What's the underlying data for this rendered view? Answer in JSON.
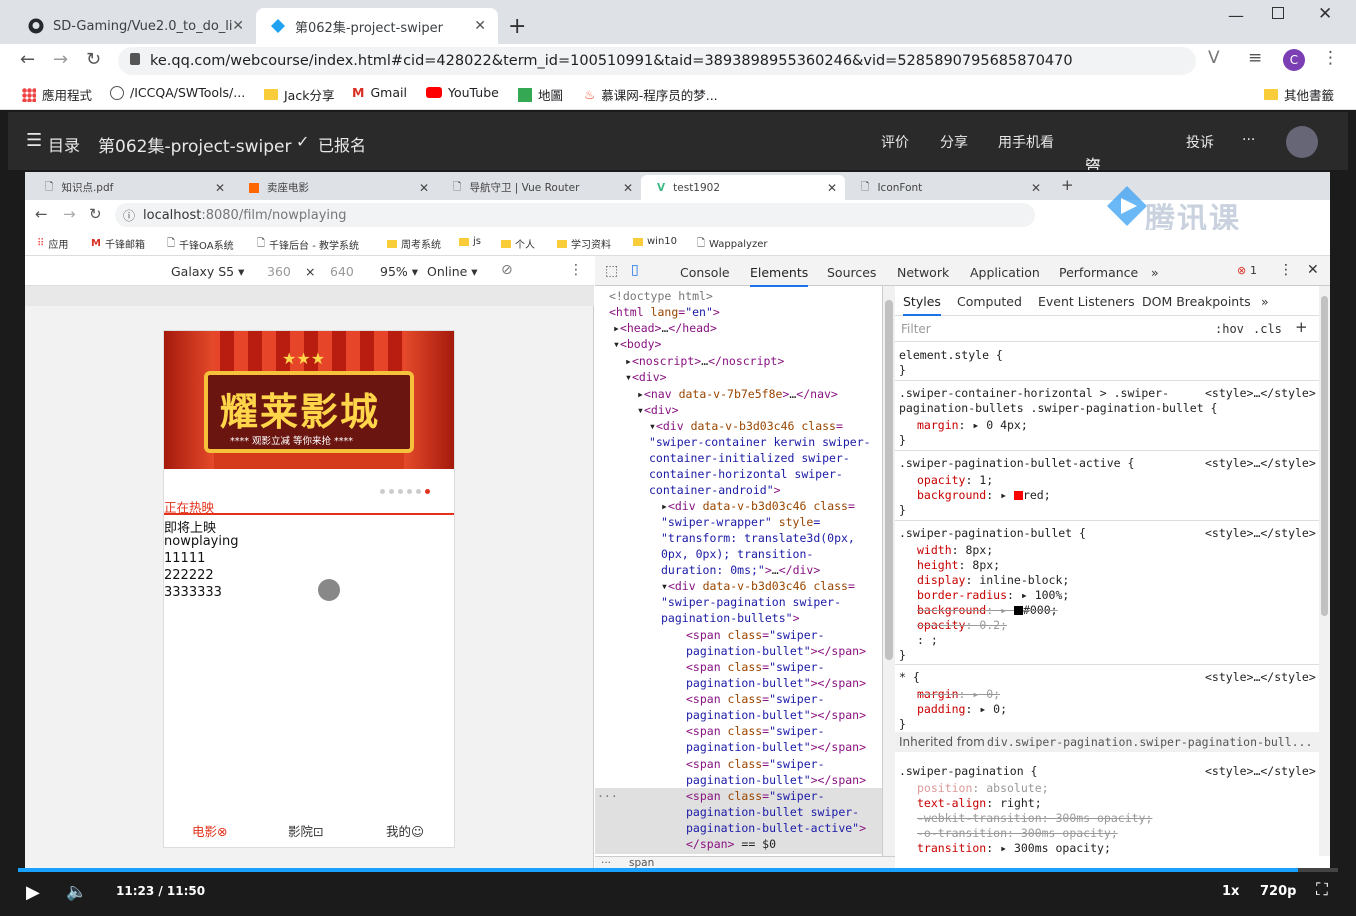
{
  "outer": {
    "tabs": [
      {
        "label": "SD-Gaming/Vue2.0_to_do_list",
        "icon": "github-icon"
      },
      {
        "label": "第062集-project-swiper",
        "icon": "tencent-classroom-icon"
      }
    ],
    "url": "ke.qq.com/webcourse/index.html#cid=428022&term_id=100510991&taid=3893898955360246&vid=5285890795685870470",
    "bookmarks": [
      "應用程式",
      "/ICCQA/SWTools/...",
      "Jack分享",
      "Gmail",
      "YouTube",
      "地圖",
      "慕课网-程序员的梦...",
      "其他書籤"
    ],
    "profile_initial": "C"
  },
  "site": {
    "menu": "目录",
    "title": "第062集-project-swiper",
    "enrolled": "已报名",
    "actions": [
      "评价",
      "分享",
      "用手机看",
      "咨询老师",
      "投诉",
      "···"
    ]
  },
  "inner": {
    "tabs": [
      "知识点.pdf",
      "卖座电影",
      "导航守卫 | Vue Router",
      "test1902",
      "IconFont"
    ],
    "url_host": "localhost",
    "url_path": ":8080/film/nowplaying",
    "bookmarks": [
      "应用",
      "千锋邮箱",
      "千锋OA系统",
      "千锋后台 - 教学系统",
      "周考系统",
      "js",
      "个人",
      "学习资料",
      "win10",
      "Wappalyzer"
    ],
    "watermark": "腾讯课堂"
  },
  "device": {
    "model": "Galaxy S5",
    "width": "360",
    "times": "×",
    "height": "640",
    "zoom": "95%",
    "network": "Online"
  },
  "app": {
    "banner_title": "耀莱影城",
    "banner_sub": "**** 观影立减 等你来抢 ****",
    "lines": [
      "正在热映",
      "即将上映",
      "nowplaying",
      "11111",
      "222222",
      "3333333"
    ],
    "tabbar": [
      "电影",
      "影院",
      "我的"
    ]
  },
  "devtools": {
    "tabs": [
      "Console",
      "Elements",
      "Sources",
      "Network",
      "Application",
      "Performance",
      "»"
    ],
    "error_count": "1",
    "style_tabs": [
      "Styles",
      "Computed",
      "Event Listeners",
      "DOM Breakpoints",
      "»"
    ],
    "filter_placeholder": "Filter",
    "hov": ":hov",
    "cls": ".cls",
    "inherited_label": "Inherited from",
    "inherited_selector": "div.swiper-pagination.swiper-pagination-bull...",
    "bottom_crumb": "span"
  },
  "player": {
    "time": "11:23 / 11:50",
    "speed": "1x",
    "quality": "720p",
    "progress": 0.97
  }
}
